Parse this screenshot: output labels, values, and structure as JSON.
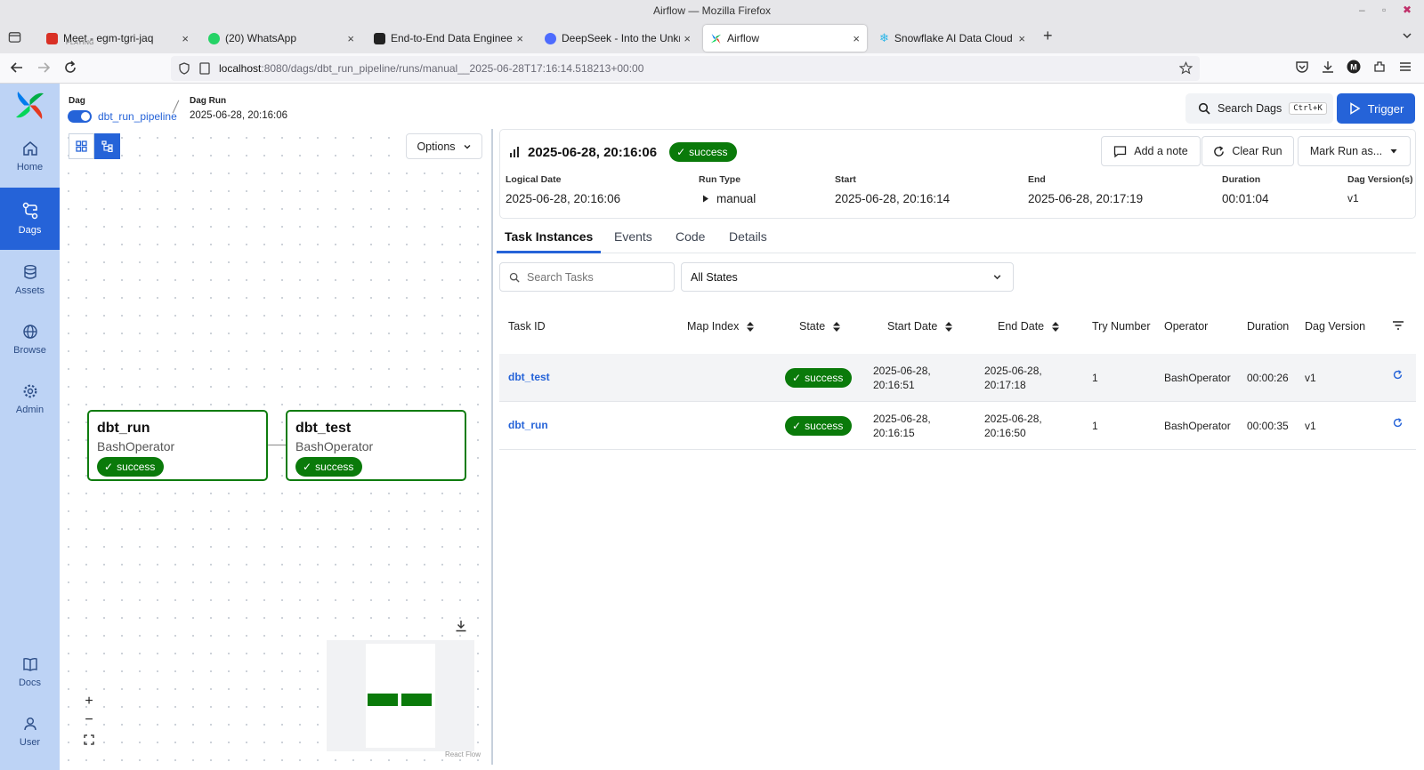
{
  "browser": {
    "window_title": "Airflow — Mozilla Firefox",
    "tabs": [
      {
        "title": "Meet - egm-tgri-jaq",
        "sub": "PLAYING",
        "color": "#d93025"
      },
      {
        "title": "(20) WhatsApp",
        "color": "#25d366"
      },
      {
        "title": "End-to-End Data Engineering",
        "color": "#222222"
      },
      {
        "title": "DeepSeek - Into the Unknow",
        "color": "#4d6bfe"
      },
      {
        "title": "Airflow",
        "color": "#017cee"
      },
      {
        "title": "Snowflake AI Data Cloud",
        "color": "#29b5e8"
      }
    ],
    "url_host": "localhost",
    "url_rest": ":8080/dags/dbt_run_pipeline/runs/manual__2025-06-28T17:16:14.518213+00:00"
  },
  "sidebar": {
    "items": [
      {
        "label": "Home",
        "icon": "home-icon"
      },
      {
        "label": "Dags",
        "icon": "dags-icon"
      },
      {
        "label": "Assets",
        "icon": "database-icon"
      },
      {
        "label": "Browse",
        "icon": "globe-icon"
      },
      {
        "label": "Admin",
        "icon": "gear-icon"
      },
      {
        "label": "Docs",
        "icon": "book-icon"
      },
      {
        "label": "User",
        "icon": "user-icon"
      }
    ]
  },
  "header": {
    "dag_label": "Dag",
    "dag_name": "dbt_run_pipeline",
    "dag_run_label": "Dag Run",
    "dag_run_value": "2025-06-28, 20:16:06",
    "search_label": "Search Dags",
    "search_shortcut": "Ctrl+K",
    "trigger_label": "Trigger"
  },
  "graph": {
    "options_label": "Options",
    "nodes": [
      {
        "name": "dbt_run",
        "operator": "BashOperator",
        "state": "success"
      },
      {
        "name": "dbt_test",
        "operator": "BashOperator",
        "state": "success"
      }
    ],
    "attribution": "React Flow",
    "zoom_in": "+",
    "zoom_out": "−"
  },
  "run": {
    "title": "2025-06-28, 20:16:06",
    "state": "success",
    "add_note": "Add a note",
    "clear_run": "Clear Run",
    "mark_run": "Mark Run as...",
    "meta": [
      {
        "label": "Logical Date",
        "value": "2025-06-28, 20:16:06"
      },
      {
        "label": "Run Type",
        "value": "manual"
      },
      {
        "label": "Start",
        "value": "2025-06-28, 20:16:14"
      },
      {
        "label": "End",
        "value": "2025-06-28, 20:17:19"
      },
      {
        "label": "Duration",
        "value": "00:01:04"
      },
      {
        "label": "Dag Version(s)",
        "value": "v1"
      }
    ]
  },
  "tabs": [
    "Task Instances",
    "Events",
    "Code",
    "Details"
  ],
  "filters": {
    "search_placeholder": "Search Tasks",
    "state_selected": "All States"
  },
  "table": {
    "columns": [
      "Task ID",
      "Map Index",
      "State",
      "Start Date",
      "End Date",
      "Try Number",
      "Operator",
      "Duration",
      "Dag Version"
    ],
    "rows": [
      {
        "task_id": "dbt_test",
        "state": "success",
        "start_date": "2025-06-28,",
        "start_time": "20:16:51",
        "end_date": "2025-06-28,",
        "end_time": "20:17:18",
        "try_number": "1",
        "operator": "BashOperator",
        "duration": "00:00:26",
        "dag_version": "v1"
      },
      {
        "task_id": "dbt_run",
        "state": "success",
        "start_date": "2025-06-28,",
        "start_time": "20:16:15",
        "end_date": "2025-06-28,",
        "end_time": "20:16:50",
        "try_number": "1",
        "operator": "BashOperator",
        "duration": "00:00:35",
        "dag_version": "v1"
      }
    ]
  },
  "colors": {
    "accent": "#2563d8",
    "success": "#0a7a0a",
    "sidebar": "#bdd3f5"
  }
}
